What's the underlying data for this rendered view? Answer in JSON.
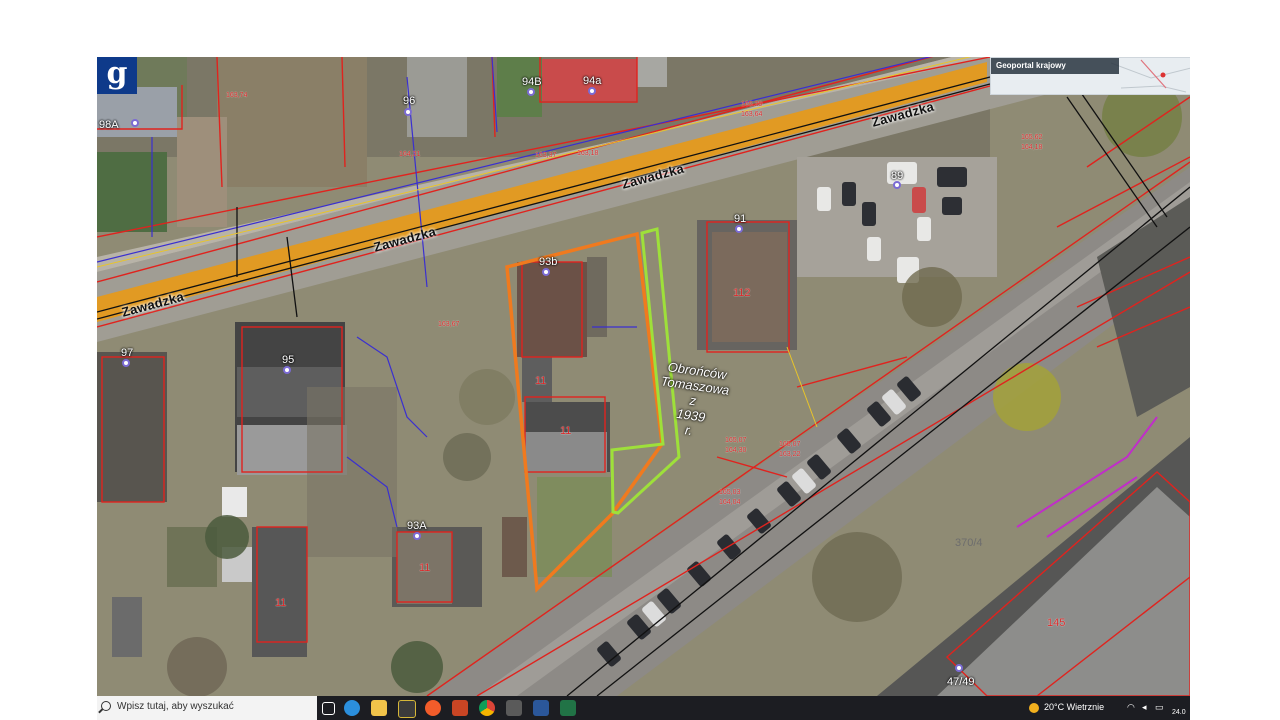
{
  "map": {
    "logo_letter": "g",
    "overview_title": "Geoportal krajowy",
    "street_labels": [
      "Zawadzka",
      "Zawadzka",
      "Zawadzka"
    ],
    "memorial_text": [
      "Obrońców",
      "Tomaszowa",
      "z",
      "1939",
      "r."
    ],
    "house_numbers": [
      "98A",
      "96",
      "94B",
      "94a",
      "89",
      "91",
      "93b",
      "97",
      "95",
      "93A",
      "47/49"
    ],
    "plot_labels": {
      "p1": "112",
      "p2": "11",
      "p3": "11",
      "p4": "11",
      "p5": "11",
      "p6": "370/4",
      "p7": "145"
    },
    "elevations": [
      "163,74",
      "164,31",
      "163,37",
      "163,18",
      "165,29",
      "163,64",
      "165,62",
      "164,18",
      "163,67",
      "165,07",
      "164,30",
      "165,07",
      "163,22",
      "165,03",
      "164,04"
    ],
    "colors": {
      "selected_plot_outline": "#f07a1e",
      "neighbor_outline": "#9ee03a",
      "street_axis": "#e59a1c",
      "parcel_lines": "#e0231e"
    }
  },
  "taskbar": {
    "search_placeholder": "Wpisz tutaj, aby wyszukać",
    "apps": [
      "task-view",
      "edge",
      "file-explorer",
      "archiver",
      "firefox",
      "powerpoint",
      "chrome",
      "media",
      "word",
      "excel"
    ],
    "weather": "20°C  Wietrznie",
    "clock_date": "24.0"
  }
}
